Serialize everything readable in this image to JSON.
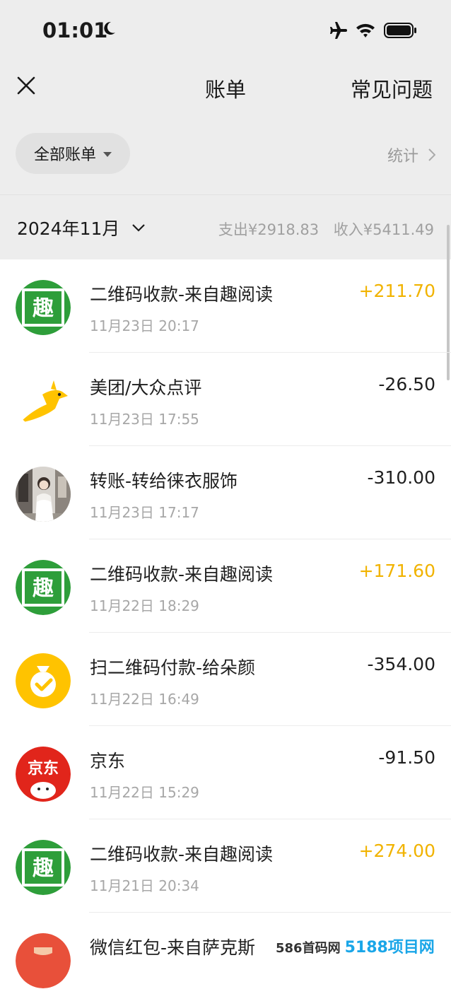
{
  "status_bar": {
    "time": "01:01"
  },
  "nav": {
    "title": "账单",
    "faq": "常见问题"
  },
  "filter": {
    "label": "全部账单",
    "stats": "统计"
  },
  "month": {
    "label": "2024年11月",
    "expense": "支出¥2918.83",
    "income": "收入¥5411.49"
  },
  "transactions": [
    {
      "title": "二维码收款-来自趣阅读",
      "time": "11月23日 20:17",
      "amount": "+211.70",
      "type": "income",
      "icon": "qu-reading-logo"
    },
    {
      "title": "美团/大众点评",
      "time": "11月23日 17:55",
      "amount": "-26.50",
      "type": "expense",
      "icon": "meituan-kangaroo-logo"
    },
    {
      "title": "转账-转给徕衣服饰",
      "time": "11月23日 17:17",
      "amount": "-310.00",
      "type": "expense",
      "icon": "user-photo-avatar"
    },
    {
      "title": "二维码收款-来自趣阅读",
      "time": "11月22日 18:29",
      "amount": "+171.60",
      "type": "income",
      "icon": "qu-reading-logo"
    },
    {
      "title": "扫二维码付款-给朵颜",
      "time": "11月22日 16:49",
      "amount": "-354.00",
      "type": "expense",
      "icon": "money-bag-logo"
    },
    {
      "title": "京东",
      "time": "11月22日 15:29",
      "amount": "-91.50",
      "type": "expense",
      "icon": "jd-logo"
    },
    {
      "title": "二维码收款-来自趣阅读",
      "time": "11月21日 20:34",
      "amount": "+274.00",
      "type": "income",
      "icon": "qu-reading-logo"
    },
    {
      "title": "微信红包-来自萨克斯",
      "time": "",
      "amount": "",
      "type": "expense",
      "icon": "red-packet-logo"
    }
  ],
  "watermark": {
    "site": "586首码网",
    "brand": "5188项目网"
  },
  "colors": {
    "income": "#f1b300",
    "background": "#ededed",
    "qu_green": "#2e9e3a",
    "jd_red": "#e1251b",
    "meituan_yellow": "#ffc300"
  }
}
